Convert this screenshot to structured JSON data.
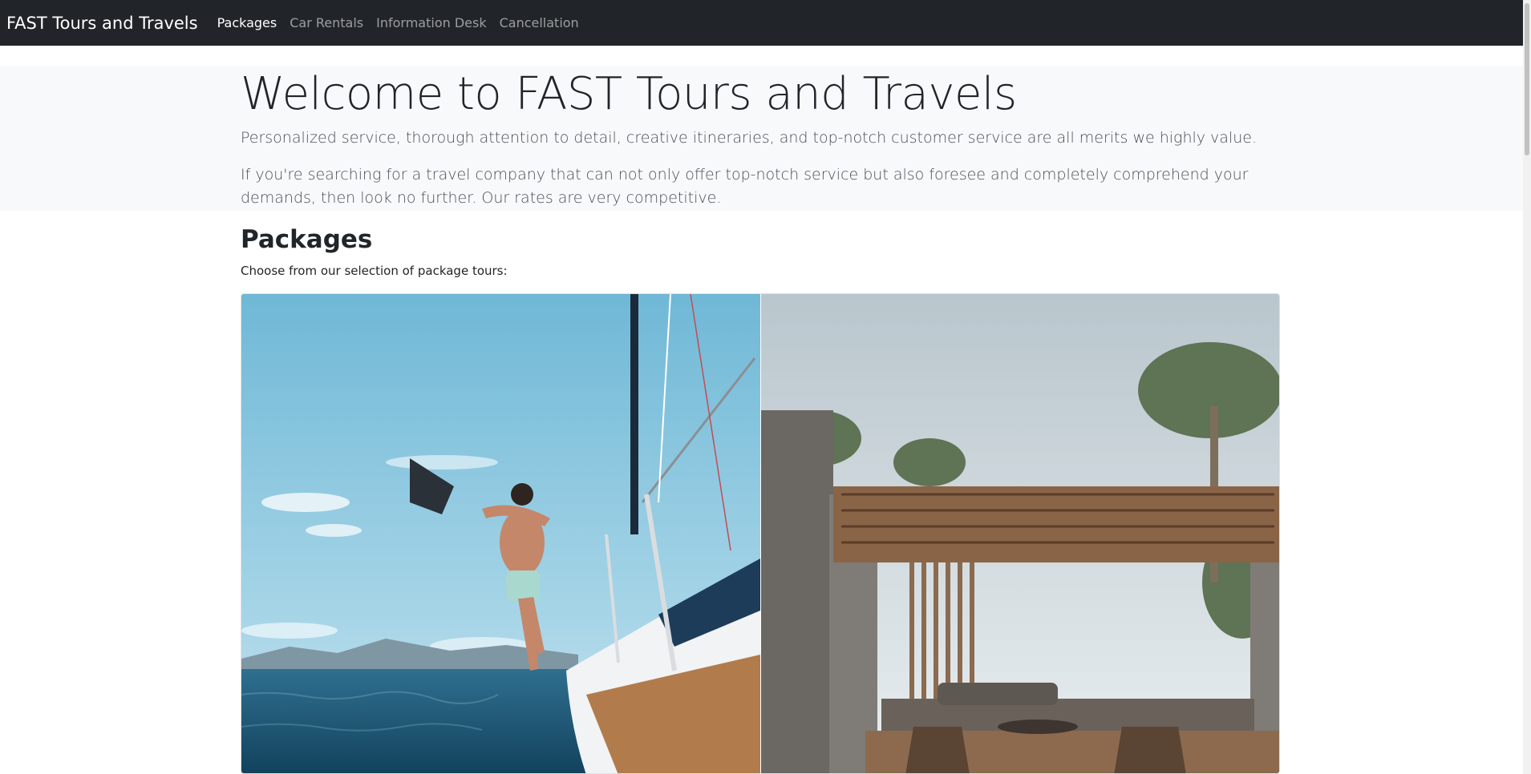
{
  "navbar": {
    "brand": "FAST Tours and Travels",
    "links": [
      {
        "label": "Packages",
        "active": true
      },
      {
        "label": "Car Rentals",
        "active": false
      },
      {
        "label": "Information Desk",
        "active": false
      },
      {
        "label": "Cancellation",
        "active": false
      }
    ]
  },
  "hero": {
    "title": "Welcome to FAST Tours and Travels",
    "lead1": "Personalized service, thorough attention to detail, creative itineraries, and top-notch customer service are all merits we highly value.",
    "lead2": "If you're searching for a travel company that can not only offer top-notch service but also foresee and completely comprehend your demands, then look no further. Our rates are very competitive."
  },
  "packages": {
    "title": "Packages",
    "subtitle": "Choose from our selection of package tours:"
  },
  "colors": {
    "navbar_bg": "#212529",
    "hero_bg": "#f8f9fa",
    "sky": "#79bdd8",
    "sea": "#1c5877"
  }
}
